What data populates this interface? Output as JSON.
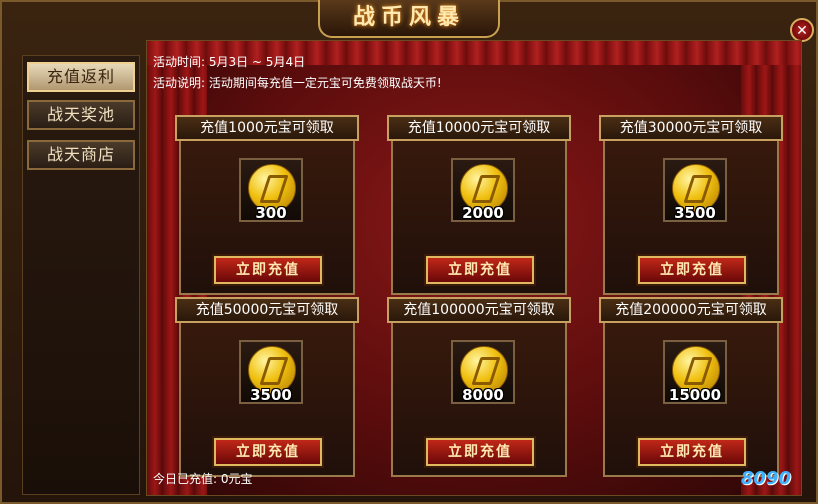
{
  "window": {
    "title": "战币风暴",
    "close_glyph": "✕"
  },
  "sidebar": {
    "tabs": [
      {
        "label": "充值返利"
      },
      {
        "label": "战天奖池"
      },
      {
        "label": "战天商店"
      }
    ]
  },
  "event": {
    "time_label": "活动时间: 5月3日 ~ 5月4日",
    "desc_label": "活动说明: 活动期间每充值一定元宝可免费领取战天币!"
  },
  "rewards": [
    {
      "title": "充值1000元宝可领取",
      "amount": "300",
      "button": "立即充值"
    },
    {
      "title": "充值10000元宝可领取",
      "amount": "2000",
      "button": "立即充值"
    },
    {
      "title": "充值30000元宝可领取",
      "amount": "3500",
      "button": "立即充值"
    },
    {
      "title": "充值50000元宝可领取",
      "amount": "3500",
      "button": "立即充值"
    },
    {
      "title": "充值100000元宝可领取",
      "amount": "8000",
      "button": "立即充值"
    },
    {
      "title": "充值200000元宝可领取",
      "amount": "15000",
      "button": "立即充值"
    }
  ],
  "footer": {
    "today_label": "今日已充值: 0元宝"
  },
  "watermark": {
    "text": "8090"
  }
}
